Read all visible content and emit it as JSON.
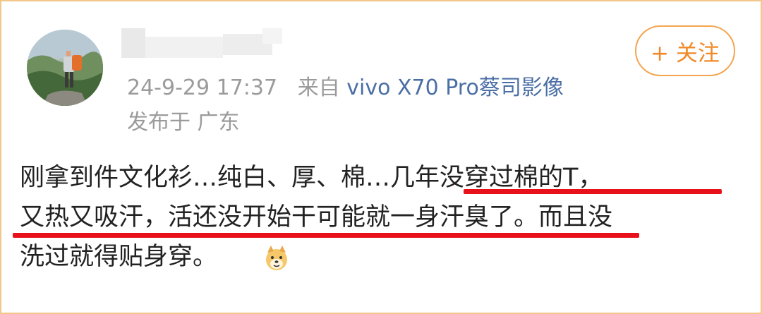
{
  "post": {
    "timestamp": "24-9-29 17:37",
    "source_prefix": "来自",
    "source": "vivo X70 Pro蔡司影像",
    "location": "发布于 广东",
    "follow_label": "+ 关注",
    "content_lines": [
      "刚拿到件文化衫…纯白、厚、棉…几年没穿过棉的T，",
      "又热又吸汗，活还没开始干可能就一身汗臭了。而且没",
      "洗过就得贴身穿。"
    ],
    "emoji": "doge-emoji"
  },
  "colors": {
    "frame": "#f3c68a",
    "accent": "#f08a28",
    "source_link": "#4a6ea5",
    "underline": "#e8111b",
    "meta": "#9b9b9b"
  }
}
